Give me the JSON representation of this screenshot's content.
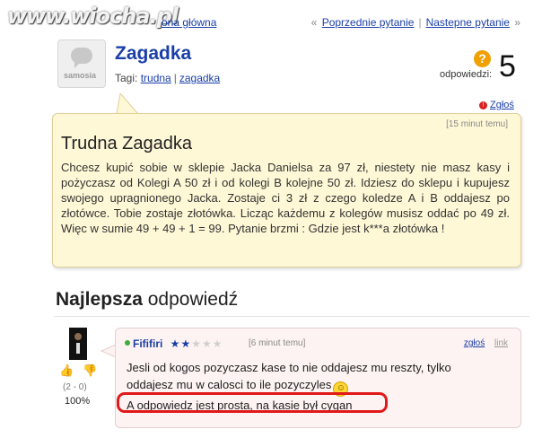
{
  "watermark": "www.wiocha.pl",
  "topnav": {
    "left_partial": "ona główna",
    "prev_arrow": "«",
    "prev": "Poprzednie pytanie",
    "sep": "|",
    "next": "Nastepne pytanie",
    "next_arrow": "»"
  },
  "logo_text": "samosia",
  "question": {
    "title": "Zagadka",
    "tags_label": "Tagi:",
    "tags": [
      "trudna",
      "zagadka"
    ],
    "answers_icon": "?",
    "answers_label": "odpowiedzi:",
    "answers_count": "5",
    "report": "Zgłoś",
    "time": "[15 minut temu]",
    "heading": "Trudna Zagadka",
    "body": "Chcesz kupić sobie w sklepie Jacka Danielsa za 97 zł, niestety nie masz kasy i pożyczasz od Kolegi A 50 zł i od kolegi B kolejne 50 zł. Idziesz do sklepu i kupujesz swojego upragnionego Jacka. Zostaje ci 3 zł z czego koledze A i B oddajesz po złotówce. Tobie zostaje złotówka. Licząc każdemu z kolegów musisz oddać po 49 zł. Więc w sumie 49 + 49 + 1 = 99. Pytanie brzmi : Gdzie jest k***a złotówka !"
  },
  "best_answer": {
    "heading_bold": "Najlepsza",
    "heading_rest": " odpowiedź",
    "user": "Fififiri",
    "rating": 1.5,
    "time": "[6 minut temu]",
    "report": "zgłoś",
    "link": "link",
    "votes": "(2 - 0)",
    "percent": "100%",
    "line1": "Jesli od kogos pozyczasz kase to nie oddajesz mu reszty, tylko",
    "line2": "oddajesz mu w calosci to ile pozyczyles",
    "line3": "A odpowiedz jest prosta, na kasie był cygan"
  },
  "colors": {
    "link": "#1a3fa8",
    "question_bg": "#fff8d6",
    "answer_bg": "#fdf3f3",
    "highlight": "#e01818",
    "online": "#3cae3c"
  },
  "icons": [
    "question-mark-icon",
    "flag-icon",
    "thumb-up-icon",
    "thumb-down-icon",
    "smiley-icon",
    "star-icon"
  ]
}
